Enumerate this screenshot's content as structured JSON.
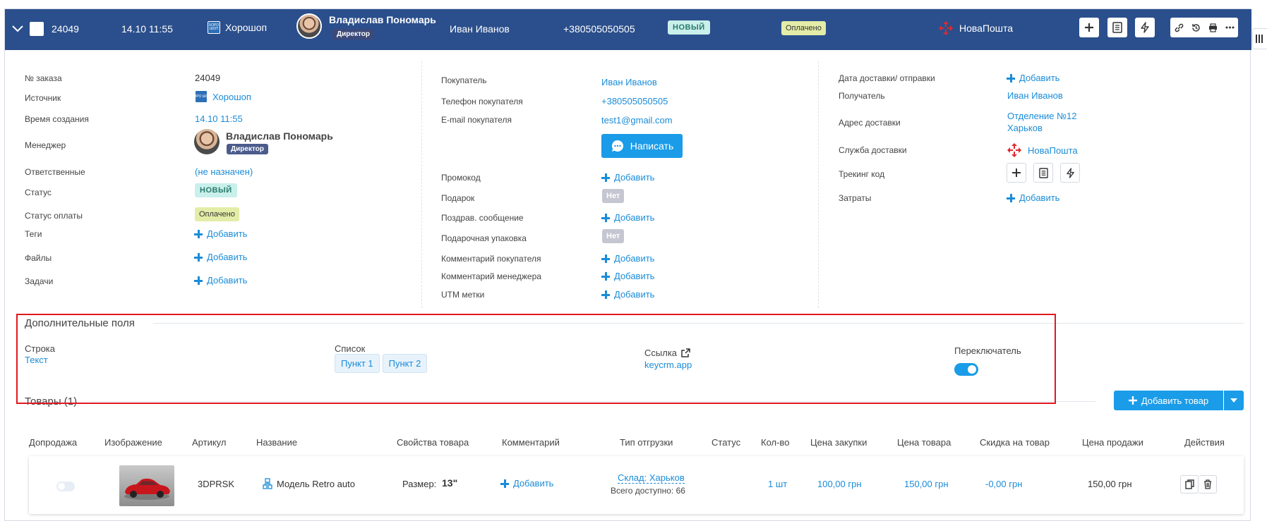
{
  "header": {
    "order_id": "24049",
    "datetime": "14.10 11:55",
    "source": "Хорошоп",
    "source_logo_text": "ХОРО ШОП",
    "manager_name": "Владислав Пономарь",
    "manager_role": "Директор",
    "customer": "Иван Иванов",
    "phone": "+380505050505",
    "status": "НОВЫЙ",
    "payment": "Оплачено",
    "delivery": "НоваПошта"
  },
  "details": {
    "col1": {
      "order_no_label": "№ заказа",
      "order_no": "24049",
      "source_label": "Источник",
      "source": "Хорошоп",
      "created_label": "Время создания",
      "created": "14.10 11:55",
      "manager_label": "Менеджер",
      "manager": "Владислав Пономарь",
      "manager_role": "Директор",
      "responsible_label": "Ответственные",
      "responsible": "(не назначен)",
      "status_label": "Статус",
      "status": "НОВЫЙ",
      "payment_label": "Статус оплаты",
      "payment": "Оплачено",
      "tags_label": "Теги",
      "files_label": "Файлы",
      "tasks_label": "Задачи",
      "add": "Добавить"
    },
    "col2": {
      "buyer_label": "Покупатель",
      "buyer": "Иван Иванов",
      "phone_label": "Телефон покупателя",
      "phone": "+380505050505",
      "email_label": "E-mail покупателя",
      "email": "test1@gmail.com",
      "write_button": "Написать",
      "promo_label": "Промокод",
      "gift_label": "Подарок",
      "gift": "Нет",
      "greeting_label": "Поздрав. сообщение",
      "wrap_label": "Подарочная упаковка",
      "wrap": "Нет",
      "buyer_comment_label": "Комментарий покупателя",
      "manager_comment_label": "Комментарий менеджера",
      "utm_label": "UTM метки",
      "add": "Добавить"
    },
    "col3": {
      "delivery_date_label": "Дата доставки/ отправки",
      "recipient_label": "Получатель",
      "recipient": "Иван Иванов",
      "address_label": "Адрес доставки",
      "address_line1": "Отделение №12",
      "address_line2": "Харьков",
      "service_label": "Служба доставки",
      "service": "НоваПошта",
      "tracking_label": "Трекинг код",
      "costs_label": "Затраты",
      "add": "Добавить"
    }
  },
  "extra": {
    "title": "Дополнительные поля",
    "string_label": "Строка",
    "string_value": "Текст",
    "list_label": "Список",
    "list_items": [
      "Пункт 1",
      "Пункт 2"
    ],
    "link_label": "Ссылка",
    "link_value": "keycrm.app",
    "switch_label": "Переключатель"
  },
  "goods": {
    "title": "Товары (1)",
    "add_button": "Добавить товар",
    "columns": [
      "Допродажа",
      "Изображение",
      "Артикул",
      "Название",
      "Свойства товара",
      "Комментарий",
      "Тип отгрузки",
      "Статус",
      "Кол-во",
      "Цена закупки",
      "Цена товара",
      "Скидка на товар",
      "Цена продажи",
      "Действия"
    ],
    "row": {
      "sku": "3DPRSK",
      "name": "Модель Retro auto",
      "prop_label": "Размер:",
      "prop_value": "13\"",
      "comment": "Добавить",
      "warehouse": "Склад: Харьков",
      "available": "Всего доступно: 66",
      "qty": "1 шт",
      "purchase": "100,00 грн",
      "price": "150,00 грн",
      "discount": "-0,00 грн",
      "sale": "150,00 грн"
    }
  }
}
